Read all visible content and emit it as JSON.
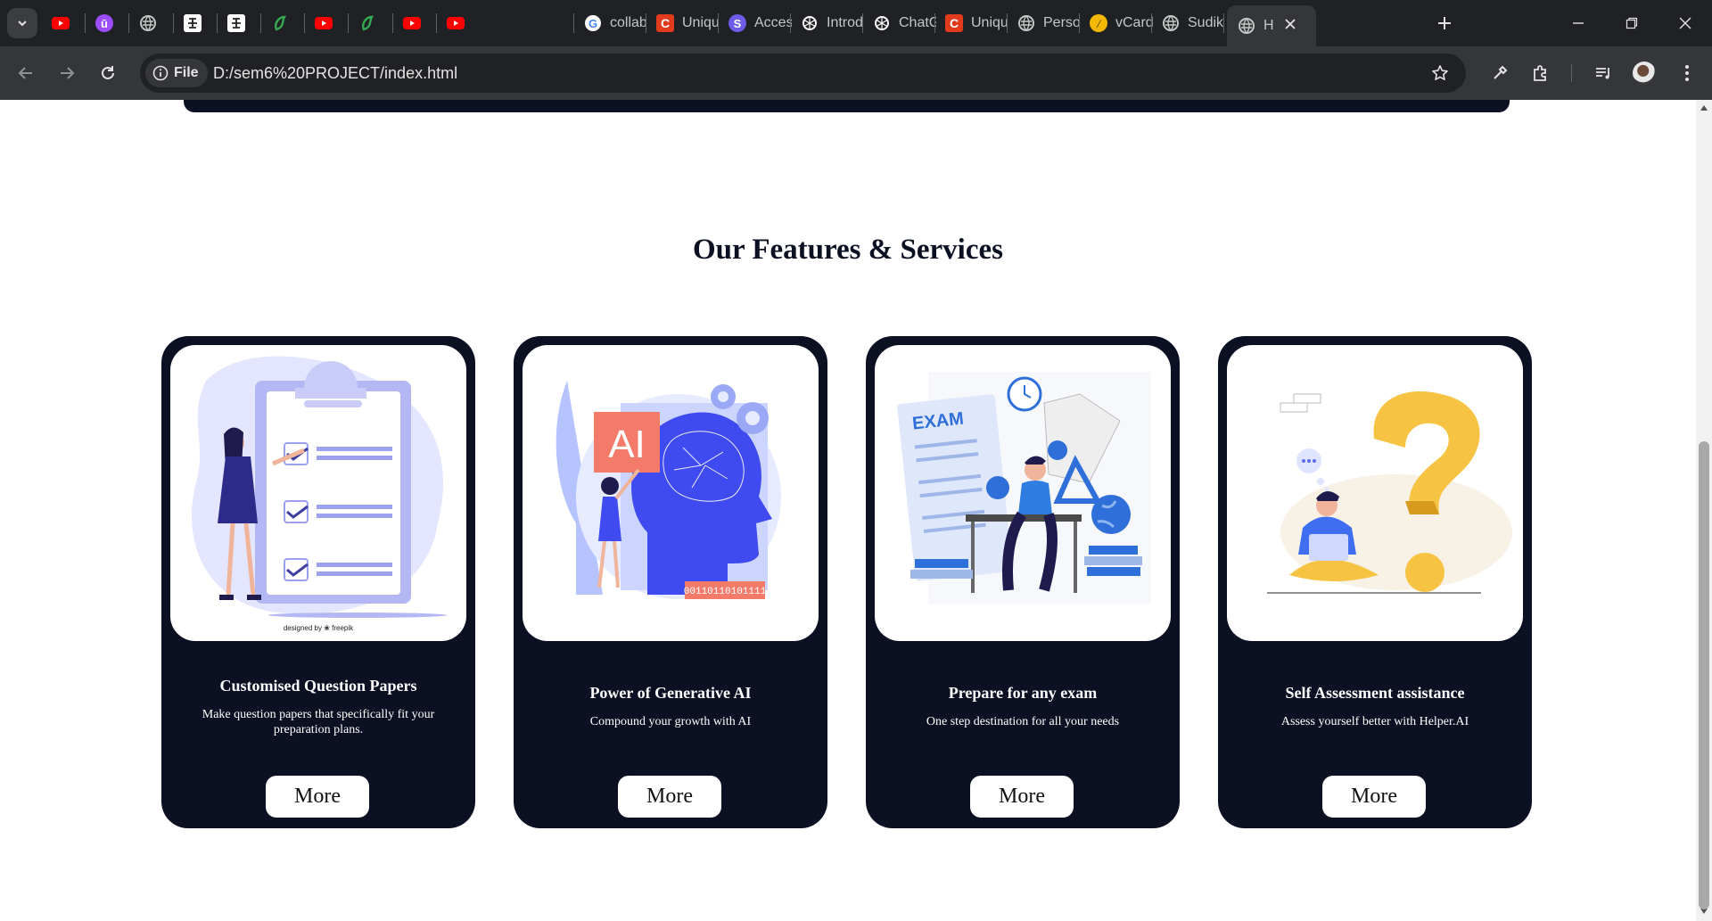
{
  "browser": {
    "tabs": [
      {
        "title": "",
        "icon": "youtube-icon",
        "color": "#ff0000"
      },
      {
        "title": "",
        "icon": "u-logo-icon",
        "color": "#9b4dff"
      },
      {
        "title": "",
        "icon": "globe-icon",
        "color": "#c4c7c5"
      },
      {
        "title": "",
        "icon": "diagram-icon",
        "color": "#ffffff"
      },
      {
        "title": "",
        "icon": "diagram-icon",
        "color": "#ffffff"
      },
      {
        "title": "",
        "icon": "green-leaf-icon",
        "color": "#34a853"
      },
      {
        "title": "",
        "icon": "youtube-icon",
        "color": "#ff0000"
      },
      {
        "title": "",
        "icon": "green-leaf-icon",
        "color": "#34a853"
      },
      {
        "title": "",
        "icon": "youtube-icon",
        "color": "#ff0000"
      },
      {
        "title": "",
        "icon": "youtube-icon",
        "color": "#ff0000"
      },
      {
        "title": "collab",
        "icon": "google-icon",
        "color": "#4285f4"
      },
      {
        "title": "Uniqu",
        "icon": "c-logo-icon",
        "color": "#e23a1c"
      },
      {
        "title": "Acces",
        "icon": "s-logo-icon",
        "color": "#6c5ce7"
      },
      {
        "title": "Introd",
        "icon": "openai-icon",
        "color": "#ffffff"
      },
      {
        "title": "ChatG",
        "icon": "openai-icon",
        "color": "#ffffff"
      },
      {
        "title": "Uniqu",
        "icon": "c-logo-icon",
        "color": "#e23a1c"
      },
      {
        "title": "Perso",
        "icon": "globe-icon",
        "color": "#c4c7c5"
      },
      {
        "title": "vCard",
        "icon": "v-logo-icon",
        "color": "#f5b800"
      },
      {
        "title": "Sudik",
        "icon": "globe-icon",
        "color": "#c4c7c5"
      },
      {
        "title": "H",
        "icon": "globe-icon",
        "color": "#c4c7c5",
        "active": true
      }
    ],
    "address": {
      "chip_label": "File",
      "url": "D:/sem6%20PROJECT/index.html"
    }
  },
  "page": {
    "section_title": "Our Features & Services",
    "cards": [
      {
        "title": "Customised Question Papers",
        "description": "Make question papers that specifically fit your preparation plans.",
        "button": "More",
        "image": "clipboard-illustration",
        "credit": "designed by ❀ freepik"
      },
      {
        "title": "Power of Generative AI",
        "description": "Compound your growth with AI",
        "button": "More",
        "image": "ai-head-illustration",
        "badge_ai": "AI",
        "badge_binary": "00110110101111"
      },
      {
        "title": "Prepare for any exam",
        "description": "One step destination for all your needs",
        "button": "More",
        "image": "exam-study-illustration",
        "badge_exam": "EXAM"
      },
      {
        "title": "Self Assessment assistance",
        "description": "Assess yourself better with Helper.AI",
        "button": "More",
        "image": "question-mark-illustration"
      }
    ]
  },
  "colors": {
    "card_bg": "#0b1022",
    "accent_purple": "#7b83eb",
    "accent_blue": "#3d5afe",
    "accent_yellow": "#f6c343"
  }
}
